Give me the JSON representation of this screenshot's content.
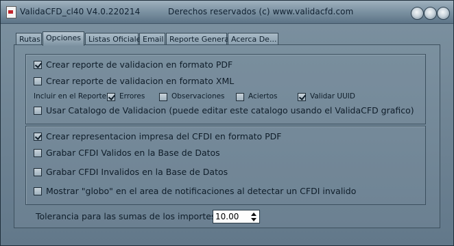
{
  "window": {
    "title_left": "ValidaCFD_cl40 V4.0.220214",
    "title_right": "Derechos reservados (c) www.validacfd.com"
  },
  "tabs": [
    {
      "label": "Rutas",
      "active": false
    },
    {
      "label": "Opciones",
      "active": true
    },
    {
      "label": "Listas Oficiales",
      "active": false
    },
    {
      "label": "Email",
      "active": false
    },
    {
      "label": "Reporte General",
      "active": false
    },
    {
      "label": "Acerca De...",
      "active": false
    }
  ],
  "group1": {
    "pdf_report": {
      "label": "Crear reporte de validacion en formato PDF",
      "checked": true
    },
    "xml_report": {
      "label": "Crear reporte de validacion en formato XML",
      "checked": false
    },
    "include_label": "Incluir en el Reporte",
    "include_options": [
      {
        "label": "Errores",
        "checked": true
      },
      {
        "label": "Observaciones",
        "checked": false
      },
      {
        "label": "Aciertos",
        "checked": false
      },
      {
        "label": "Validar UUID",
        "checked": true
      }
    ],
    "catalog": {
      "label": "Usar Catalogo de Validacion (puede editar este catalogo usando el ValidaCFD grafico)",
      "checked": false
    }
  },
  "group2": {
    "items": [
      {
        "label": "Crear representacion impresa del CFDI en formato PDF",
        "checked": true
      },
      {
        "label": "Grabar CFDI Validos en la Base de Datos",
        "checked": false
      },
      {
        "label": "Grabar CFDI Invalidos en la Base de Datos",
        "checked": false
      },
      {
        "label": "Mostrar \"globo\" en el area de notificaciones al detectar un CFDI invalido",
        "checked": false
      }
    ]
  },
  "tolerance": {
    "label": "Tolerancia para las sumas de los importes",
    "value": "10.00"
  }
}
